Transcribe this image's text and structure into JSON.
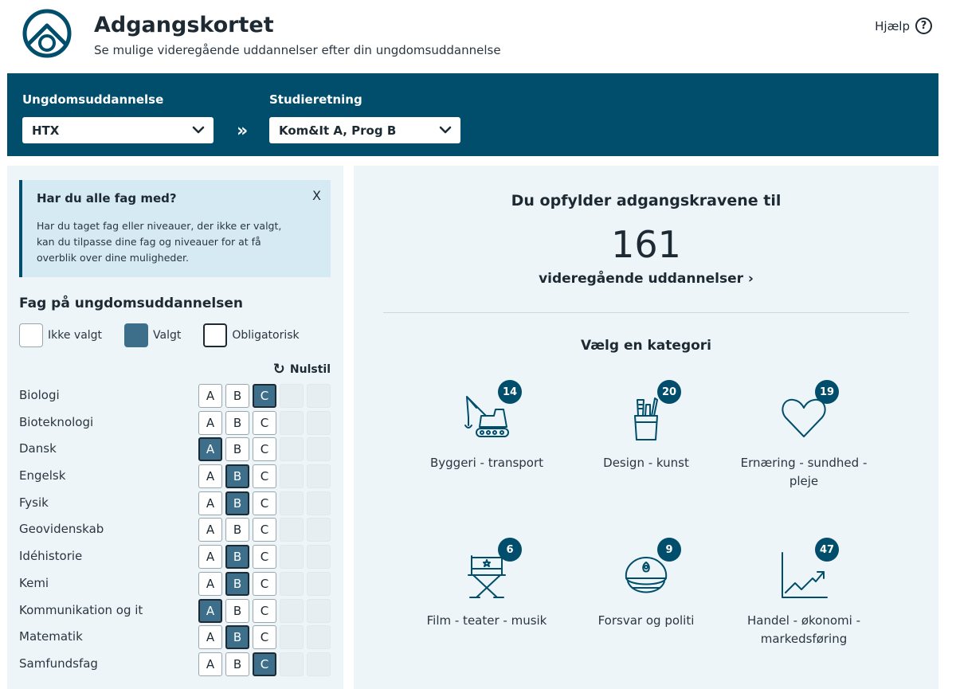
{
  "header": {
    "title": "Adgangskortet",
    "subtitle": "Se mulige videregående uddannelser efter din ungdomsuddannelse",
    "help_label": "Hjælp",
    "help_icon": "?"
  },
  "selectors": {
    "ungdom_label": "Ungdomsuddannelse",
    "ungdom_value": "HTX",
    "arrows": "»",
    "studie_label": "Studieretning",
    "studie_value": "Kom&It A, Prog B"
  },
  "info": {
    "title": "Har du alle fag med?",
    "close": "X",
    "text": "Har du taget fag eller niveauer, der ikke er valgt, kan du tilpasse dine fag og niveauer for at få overblik over dine muligheder."
  },
  "fag": {
    "heading": "Fag på ungdomsuddannelsen",
    "legend": {
      "not_selected": "Ikke valgt",
      "selected": "Valgt",
      "mandatory": "Obligatorisk"
    },
    "reset_label": "Nulstil",
    "reset_icon": "↻",
    "level_labels": [
      "A",
      "B",
      "C"
    ],
    "subjects": [
      {
        "name": "Biologi",
        "selected": "C"
      },
      {
        "name": "Bioteknologi",
        "selected": ""
      },
      {
        "name": "Dansk",
        "selected": "A"
      },
      {
        "name": "Engelsk",
        "selected": "B"
      },
      {
        "name": "Fysik",
        "selected": "B"
      },
      {
        "name": "Geovidenskab",
        "selected": ""
      },
      {
        "name": "Idéhistorie",
        "selected": "B"
      },
      {
        "name": "Kemi",
        "selected": "B"
      },
      {
        "name": "Kommunikation og it",
        "selected": "A"
      },
      {
        "name": "Matematik",
        "selected": "B"
      },
      {
        "name": "Samfundsfag",
        "selected": "C"
      }
    ]
  },
  "results": {
    "heading": "Du opfylder adgangskravene til",
    "count": "161",
    "link_label": "videregående uddannelser ›",
    "category_heading": "Vælg en kategori",
    "categories": [
      {
        "label": "Byggeri - transport",
        "count": "14",
        "icon": "crane-icon"
      },
      {
        "label": "Design - kunst",
        "count": "20",
        "icon": "art-supplies-icon"
      },
      {
        "label": "Ernæring - sundhed - pleje",
        "count": "19",
        "icon": "heart-icon"
      },
      {
        "label": "Film - teater - musik",
        "count": "6",
        "icon": "director-chair-icon"
      },
      {
        "label": "Forsvar og politi",
        "count": "9",
        "icon": "police-cap-icon"
      },
      {
        "label": "Handel - økonomi - markedsføring",
        "count": "47",
        "icon": "trend-chart-icon"
      }
    ]
  },
  "colors": {
    "primary": "#004e6b",
    "selected": "#3e6f8a",
    "panel": "#eef5f8",
    "info": "#d5eaf2"
  }
}
